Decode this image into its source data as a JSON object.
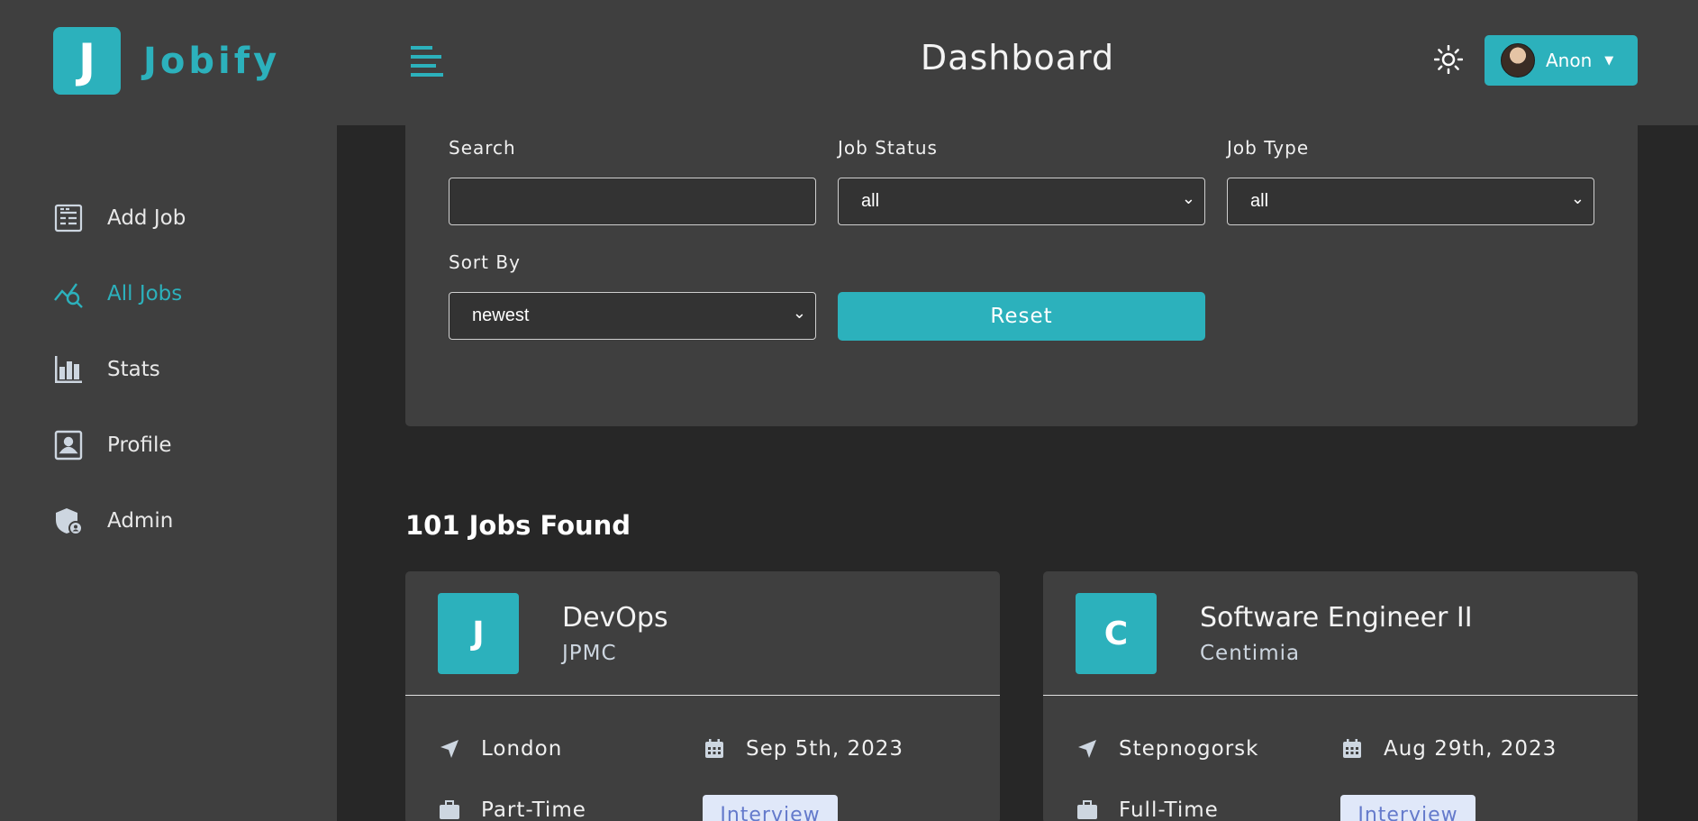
{
  "brand": {
    "logo_letter": "J",
    "name": "Jobify"
  },
  "header": {
    "title": "Dashboard",
    "user_name": "Anon"
  },
  "sidebar": {
    "items": [
      {
        "label": "Add Job",
        "icon": "add-job-icon",
        "active": false
      },
      {
        "label": "All Jobs",
        "icon": "all-jobs-icon",
        "active": true
      },
      {
        "label": "Stats",
        "icon": "stats-icon",
        "active": false
      },
      {
        "label": "Profile",
        "icon": "profile-icon",
        "active": false
      },
      {
        "label": "Admin",
        "icon": "admin-shield-icon",
        "active": false
      }
    ]
  },
  "filters": {
    "search_label": "Search",
    "search_value": "",
    "status_label": "Job Status",
    "status_value": "all",
    "type_label": "Job Type",
    "type_value": "all",
    "sort_label": "Sort By",
    "sort_value": "newest",
    "reset_label": "Reset"
  },
  "jobs_found": "101 Jobs Found",
  "jobs": [
    {
      "initial": "J",
      "position": "DevOps",
      "company": "JPMC",
      "location": "London",
      "date": "Sep 5th, 2023",
      "type": "Part-Time",
      "status": "Interview"
    },
    {
      "initial": "C",
      "position": "Software Engineer II",
      "company": "Centimia",
      "location": "Stepnogorsk",
      "date": "Aug 29th, 2023",
      "type": "Full-Time",
      "status": "Interview"
    }
  ],
  "colors": {
    "accent": "#2cb1bc",
    "surface": "#3f3f3f",
    "background": "#272727",
    "status_bg": "#e0e8f9",
    "status_text": "#647acb"
  }
}
